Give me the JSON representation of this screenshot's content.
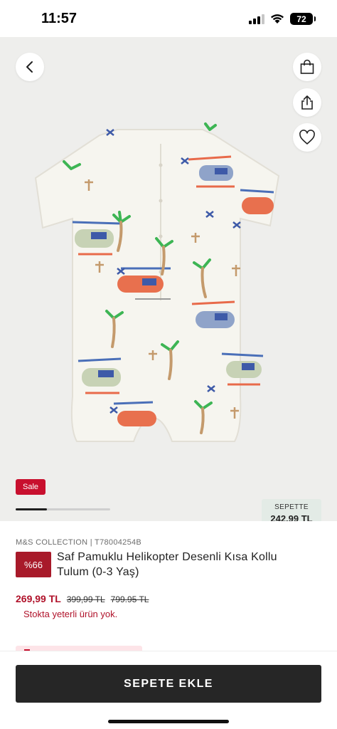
{
  "status_bar": {
    "time": "11:57",
    "battery": "72",
    "icons": [
      "signal-icon",
      "wifi-icon",
      "battery-icon"
    ]
  },
  "toolbar": {
    "back_icon": "chevron-left-icon",
    "bag_icon": "shopping-bag-icon",
    "share_icon": "share-icon",
    "favorite_icon": "heart-icon"
  },
  "gallery": {
    "sale_label": "Sale",
    "progress": 0.33
  },
  "basket_summary": {
    "label": "SEPETTE",
    "total": "242.99 TL"
  },
  "product": {
    "brand_line": "M&S COLLECTION | T78004254B",
    "discount": "%66",
    "title": "Saf Pamuklu Helikopter Desenli Kısa Kollu Tulum (0-3 Yaş)",
    "price_current": "269,99 TL",
    "price_old_1": "399,99 TL",
    "price_old_2": "799.95 TL",
    "stock_message": "Stokta yeterli ürün yok."
  },
  "actions": {
    "add_to_cart": "SEPETE EKLE"
  },
  "colors": {
    "accent_red": "#c8102e",
    "discount_red": "#a81a2a",
    "button_dark": "#262626",
    "image_bg": "#eeeeec",
    "basket_bg": "#e3ebe6"
  }
}
